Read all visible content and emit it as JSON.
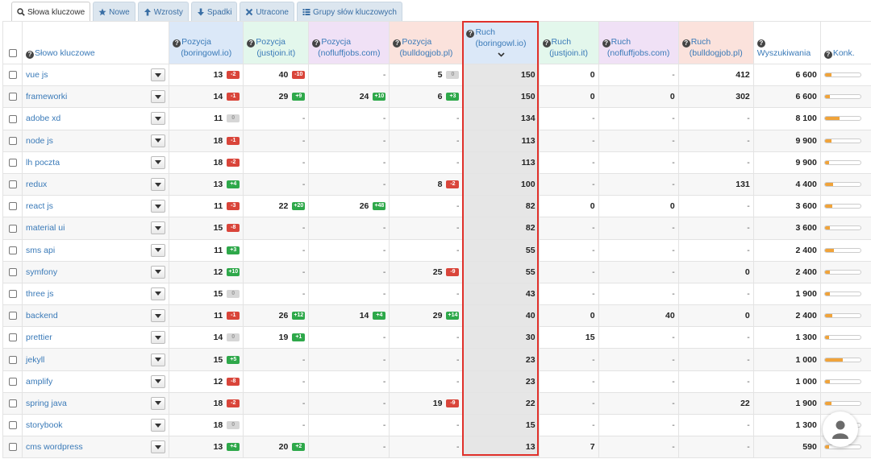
{
  "tabs": [
    {
      "label": "Słowa kluczowe",
      "icon": "search-icon",
      "active": true
    },
    {
      "label": "Nowe",
      "icon": "star-icon"
    },
    {
      "label": "Wzrosty",
      "icon": "arrow-up-icon"
    },
    {
      "label": "Spadki",
      "icon": "arrow-down-icon"
    },
    {
      "label": "Utracone",
      "icon": "x-icon"
    },
    {
      "label": "Grupy słów kluczowych",
      "icon": "list-icon"
    }
  ],
  "columns": {
    "keyword": "Słowo kluczowe",
    "pos_boring": {
      "title": "Pozycja",
      "sub": "(boringowl.io)"
    },
    "pos_justjoin": {
      "title": "Pozycja",
      "sub": "(justjoin.it)"
    },
    "pos_nofluff": {
      "title": "Pozycja",
      "sub": "(nofluffjobs.com)"
    },
    "pos_bulldog": {
      "title": "Pozycja",
      "sub": "(bulldogjob.pl)"
    },
    "traffic_boring": {
      "title": "Ruch",
      "sub": "(boringowl.io)"
    },
    "traffic_justjoin": {
      "title": "Ruch",
      "sub": "(justjoin.it)"
    },
    "traffic_nofluff": {
      "title": "Ruch",
      "sub": "(nofluffjobs.com)"
    },
    "traffic_bulldog": {
      "title": "Ruch",
      "sub": "(bulldogjob.pl)"
    },
    "searches": "Wyszukiwania",
    "competition": "Konk."
  },
  "rows": [
    {
      "kw": "vue js",
      "pb": [
        "13",
        "-2"
      ],
      "pj": [
        "40",
        "-10"
      ],
      "pn": null,
      "pd": [
        "5",
        "0"
      ],
      "rb": "150",
      "rj": "0",
      "rn": "-",
      "rd": "412",
      "w": "6 600",
      "k": 0.18
    },
    {
      "kw": "frameworki",
      "pb": [
        "14",
        "-1"
      ],
      "pj": [
        "29",
        "+9"
      ],
      "pn": [
        "24",
        "+10"
      ],
      "pd": [
        "6",
        "+3"
      ],
      "rb": "150",
      "rj": "0",
      "rn": "0",
      "rd": "302",
      "w": "6 600",
      "k": 0.15
    },
    {
      "kw": "adobe xd",
      "pb": [
        "11",
        "0"
      ],
      "pj": null,
      "pn": null,
      "pd": null,
      "rb": "134",
      "rj": "-",
      "rn": "-",
      "rd": "-",
      "w": "8 100",
      "k": 0.42
    },
    {
      "kw": "node js",
      "pb": [
        "18",
        "-1"
      ],
      "pj": null,
      "pn": null,
      "pd": null,
      "rb": "113",
      "rj": "-",
      "rn": "-",
      "rd": "-",
      "w": "9 900",
      "k": 0.18
    },
    {
      "kw": "lh poczta",
      "pb": [
        "18",
        "-2"
      ],
      "pj": null,
      "pn": null,
      "pd": null,
      "rb": "113",
      "rj": "-",
      "rn": "-",
      "rd": "-",
      "w": "9 900",
      "k": 0.12
    },
    {
      "kw": "redux",
      "pb": [
        "13",
        "+4"
      ],
      "pj": null,
      "pn": null,
      "pd": [
        "8",
        "-2"
      ],
      "rb": "100",
      "rj": "-",
      "rn": "-",
      "rd": "131",
      "w": "4 400",
      "k": 0.22
    },
    {
      "kw": "react js",
      "pb": [
        "11",
        "-3"
      ],
      "pj": [
        "22",
        "+20"
      ],
      "pn": [
        "26",
        "+48"
      ],
      "pd": null,
      "rb": "82",
      "rj": "0",
      "rn": "0",
      "rd": "-",
      "w": "3 600",
      "k": 0.2
    },
    {
      "kw": "material ui",
      "pb": [
        "15",
        "-8"
      ],
      "pj": null,
      "pn": null,
      "pd": null,
      "rb": "82",
      "rj": "-",
      "rn": "-",
      "rd": "-",
      "w": "3 600",
      "k": 0.15
    },
    {
      "kw": "sms api",
      "pb": [
        "11",
        "+3"
      ],
      "pj": null,
      "pn": null,
      "pd": null,
      "rb": "55",
      "rj": "-",
      "rn": "-",
      "rd": "-",
      "w": "2 400",
      "k": 0.25
    },
    {
      "kw": "symfony",
      "pb": [
        "12",
        "+10"
      ],
      "pj": null,
      "pn": null,
      "pd": [
        "25",
        "-9"
      ],
      "rb": "55",
      "rj": "-",
      "rn": "-",
      "rd": "0",
      "w": "2 400",
      "k": 0.15
    },
    {
      "kw": "three js",
      "pb": [
        "15",
        "0"
      ],
      "pj": null,
      "pn": null,
      "pd": null,
      "rb": "43",
      "rj": "-",
      "rn": "-",
      "rd": "-",
      "w": "1 900",
      "k": 0.13
    },
    {
      "kw": "backend",
      "pb": [
        "11",
        "-1"
      ],
      "pj": [
        "26",
        "+12"
      ],
      "pn": [
        "14",
        "+4"
      ],
      "pd": [
        "29",
        "+14"
      ],
      "rb": "40",
      "rj": "0",
      "rn": "40",
      "rd": "0",
      "w": "2 400",
      "k": 0.2
    },
    {
      "kw": "prettier",
      "pb": [
        "14",
        "0"
      ],
      "pj": [
        "19",
        "+1"
      ],
      "pn": null,
      "pd": null,
      "rb": "30",
      "rj": "15",
      "rn": "-",
      "rd": "-",
      "w": "1 300",
      "k": 0.12
    },
    {
      "kw": "jekyll",
      "pb": [
        "15",
        "+5"
      ],
      "pj": null,
      "pn": null,
      "pd": null,
      "rb": "23",
      "rj": "-",
      "rn": "-",
      "rd": "-",
      "w": "1 000",
      "k": 0.5
    },
    {
      "kw": "amplify",
      "pb": [
        "12",
        "-8"
      ],
      "pj": null,
      "pn": null,
      "pd": null,
      "rb": "23",
      "rj": "-",
      "rn": "-",
      "rd": "-",
      "w": "1 000",
      "k": 0.15
    },
    {
      "kw": "spring java",
      "pb": [
        "18",
        "-2"
      ],
      "pj": null,
      "pn": null,
      "pd": [
        "19",
        "-9"
      ],
      "rb": "22",
      "rj": "-",
      "rn": "-",
      "rd": "22",
      "w": "1 900",
      "k": 0.18
    },
    {
      "kw": "storybook",
      "pb": [
        "18",
        "0"
      ],
      "pj": null,
      "pn": null,
      "pd": null,
      "rb": "15",
      "rj": "-",
      "rn": "-",
      "rd": "-",
      "w": "1 300",
      "k": 0.12
    },
    {
      "kw": "cms wordpress",
      "pb": [
        "13",
        "+4"
      ],
      "pj": [
        "20",
        "+2"
      ],
      "pn": null,
      "pd": null,
      "rb": "13",
      "rj": "7",
      "rn": "-",
      "rd": "-",
      "w": "590",
      "k": 0.12
    }
  ],
  "empty_value": "-",
  "colors": {
    "negative": "#d9453a",
    "positive": "#2ea84a",
    "neutral": "#d6d6d6",
    "bar": "#f0a33a",
    "highlight_border": "#e0302a",
    "link": "#3a7ab8"
  }
}
